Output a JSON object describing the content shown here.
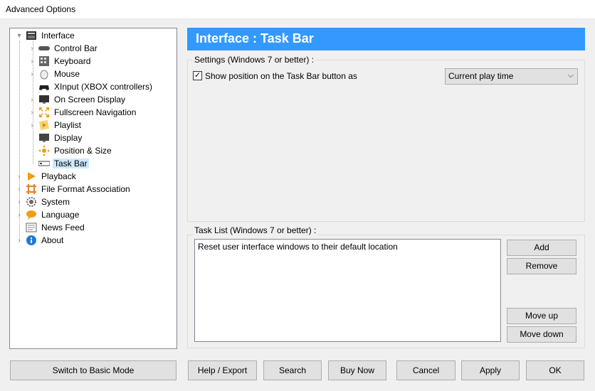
{
  "window": {
    "title": "Advanced Options"
  },
  "tree": {
    "items": [
      {
        "label": "Interface",
        "icon": "interface-icon"
      },
      {
        "label": "Control Bar",
        "icon": "control-bar-icon"
      },
      {
        "label": "Keyboard",
        "icon": "keyboard-icon"
      },
      {
        "label": "Mouse",
        "icon": "mouse-icon"
      },
      {
        "label": "XInput (XBOX controllers)",
        "icon": "gamepad-icon"
      },
      {
        "label": "On Screen Display",
        "icon": "osd-icon"
      },
      {
        "label": "Fullscreen Navigation",
        "icon": "fullscreen-icon"
      },
      {
        "label": "Playlist",
        "icon": "playlist-icon"
      },
      {
        "label": "Display",
        "icon": "display-icon"
      },
      {
        "label": "Position & Size",
        "icon": "position-icon"
      },
      {
        "label": "Task Bar",
        "icon": "taskbar-icon"
      },
      {
        "label": "Playback",
        "icon": "playback-icon"
      },
      {
        "label": "File Format Association",
        "icon": "file-format-icon"
      },
      {
        "label": "System",
        "icon": "gear-icon"
      },
      {
        "label": "Language",
        "icon": "language-icon"
      },
      {
        "label": "News Feed",
        "icon": "news-icon"
      },
      {
        "label": "About",
        "icon": "info-icon"
      }
    ]
  },
  "panel": {
    "title": "Interface : Task Bar",
    "settings_label": "Settings (Windows 7 or better) :",
    "show_position_label": "Show position on the Task Bar button as",
    "show_position_checked": "✓",
    "position_mode": "Current play time",
    "tasklist_label": "Task List (Windows 7 or better) :",
    "tasklist_items": [
      "Reset user interface windows to their default location"
    ],
    "add": "Add",
    "remove": "Remove",
    "move_up": "Move up",
    "move_down": "Move down"
  },
  "footer": {
    "basic_mode": "Switch to Basic Mode",
    "help_export": "Help / Export",
    "search": "Search",
    "buy_now": "Buy Now",
    "cancel": "Cancel",
    "apply": "Apply",
    "ok": "OK"
  },
  "colors": {
    "header_bg": "#3399ff",
    "selection": "#cce8ff"
  }
}
